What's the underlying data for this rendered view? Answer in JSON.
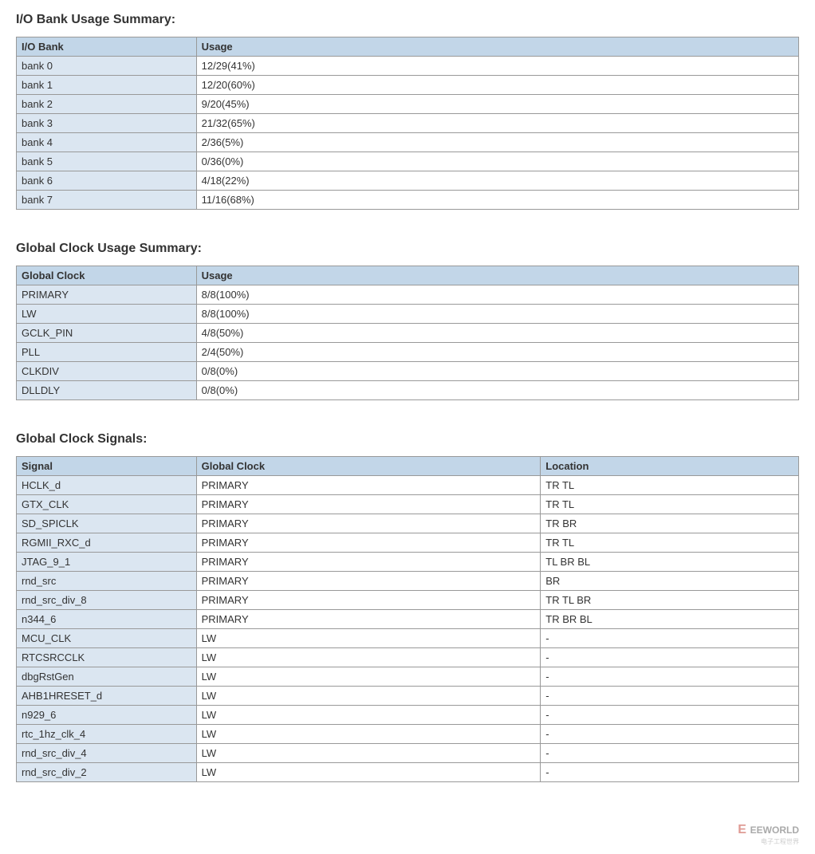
{
  "sections": {
    "io_bank": {
      "title": "I/O Bank Usage Summary:",
      "columns": [
        "I/O Bank",
        "Usage"
      ],
      "col_widths": [
        "23%",
        "77%"
      ],
      "rows": [
        [
          "bank 0",
          "12/29(41%)"
        ],
        [
          "bank 1",
          "12/20(60%)"
        ],
        [
          "bank 2",
          "9/20(45%)"
        ],
        [
          "bank 3",
          "21/32(65%)"
        ],
        [
          "bank 4",
          "2/36(5%)"
        ],
        [
          "bank 5",
          "0/36(0%)"
        ],
        [
          "bank 6",
          "4/18(22%)"
        ],
        [
          "bank 7",
          "11/16(68%)"
        ]
      ]
    },
    "global_clock_usage": {
      "title": "Global Clock Usage Summary:",
      "columns": [
        "Global Clock",
        "Usage"
      ],
      "col_widths": [
        "23%",
        "77%"
      ],
      "rows": [
        [
          "PRIMARY",
          "8/8(100%)"
        ],
        [
          "LW",
          "8/8(100%)"
        ],
        [
          "GCLK_PIN",
          "4/8(50%)"
        ],
        [
          "PLL",
          "2/4(50%)"
        ],
        [
          "CLKDIV",
          "0/8(0%)"
        ],
        [
          "DLLDLY",
          "0/8(0%)"
        ]
      ]
    },
    "global_clock_signals": {
      "title": "Global Clock Signals:",
      "columns": [
        "Signal",
        "Global Clock",
        "Location"
      ],
      "col_widths": [
        "23%",
        "44%",
        "33%"
      ],
      "rows": [
        [
          "HCLK_d",
          "PRIMARY",
          "TR TL"
        ],
        [
          "GTX_CLK",
          "PRIMARY",
          "TR TL"
        ],
        [
          "SD_SPICLK",
          "PRIMARY",
          "TR BR"
        ],
        [
          "RGMII_RXC_d",
          "PRIMARY",
          "TR TL"
        ],
        [
          "JTAG_9_1",
          "PRIMARY",
          "TL BR BL"
        ],
        [
          "rnd_src",
          "PRIMARY",
          "BR"
        ],
        [
          "rnd_src_div_8",
          "PRIMARY",
          "TR TL BR"
        ],
        [
          "n344_6",
          "PRIMARY",
          "TR BR BL"
        ],
        [
          "MCU_CLK",
          "LW",
          "-"
        ],
        [
          "RTCSRCCLK",
          "LW",
          "-"
        ],
        [
          "dbgRstGen",
          "LW",
          "-"
        ],
        [
          "AHB1HRESET_d",
          "LW",
          "-"
        ],
        [
          "n929_6",
          "LW",
          "-"
        ],
        [
          "rtc_1hz_clk_4",
          "LW",
          "-"
        ],
        [
          "rnd_src_div_4",
          "LW",
          "-"
        ],
        [
          "rnd_src_div_2",
          "LW",
          "-"
        ]
      ]
    }
  },
  "watermark": {
    "logo": "E",
    "text": "EEWORLD",
    "sub": "电子工程世界"
  }
}
